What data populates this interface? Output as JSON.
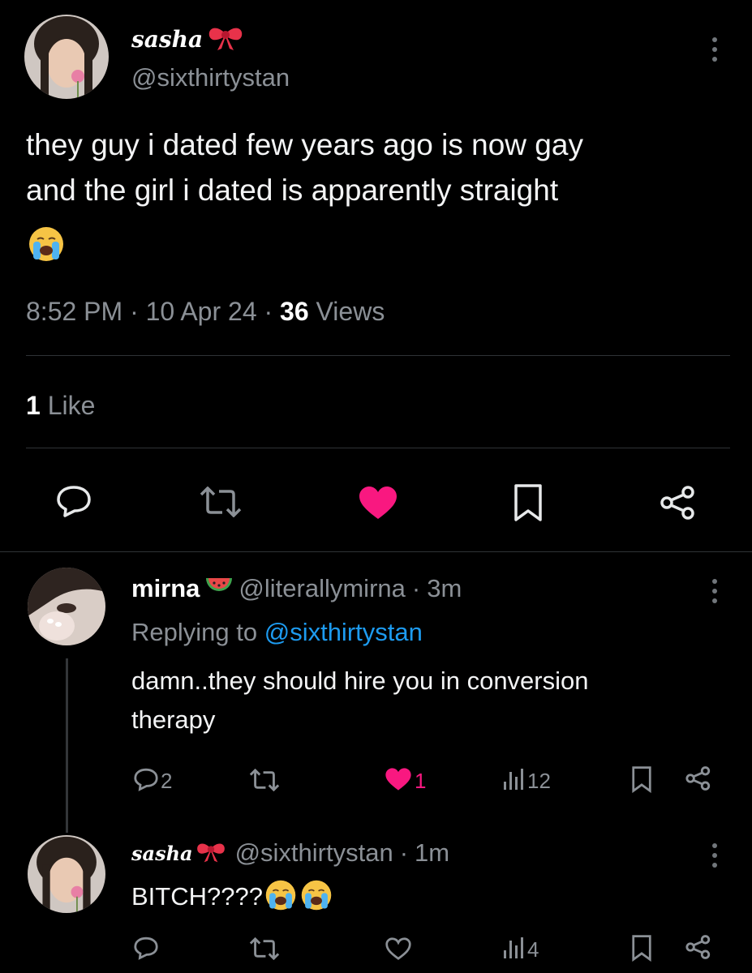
{
  "main_tweet": {
    "display_name": "sasha",
    "handle": "@sixthirtystan",
    "text_line1": "they guy i dated few years ago is now gay",
    "text_line2": "and the girl i dated is apparently straight",
    "time": "8:52 PM",
    "date": "10 Apr 24",
    "views_count": "36",
    "views_label": "Views",
    "likes_count": "1",
    "likes_label": "Like",
    "separator": "·"
  },
  "reply1": {
    "display_name": "mirna",
    "handle": "@literallymirna",
    "age": "3m",
    "replying_prefix": "Replying to",
    "replying_handle": "@sixthirtystan",
    "text_line1": "damn..they should hire you in conversion",
    "text_line2": "therapy",
    "reply_count": "2",
    "like_count": "1",
    "view_count": "12"
  },
  "reply2": {
    "display_name": "sasha",
    "handle": "@sixthirtystan",
    "age": "1m",
    "text": "BITCH????",
    "view_count": "4"
  },
  "colors": {
    "background": "#000000",
    "like_pink": "#f91880",
    "link_blue": "#1d9bf0",
    "muted_gray": "#8b9096"
  },
  "icons": [
    "bow-emoji",
    "crying-emoji",
    "watermelon-emoji",
    "more-icon",
    "reply-icon",
    "retweet-icon",
    "heart-icon",
    "bookmark-icon",
    "share-icon",
    "views-icon"
  ]
}
